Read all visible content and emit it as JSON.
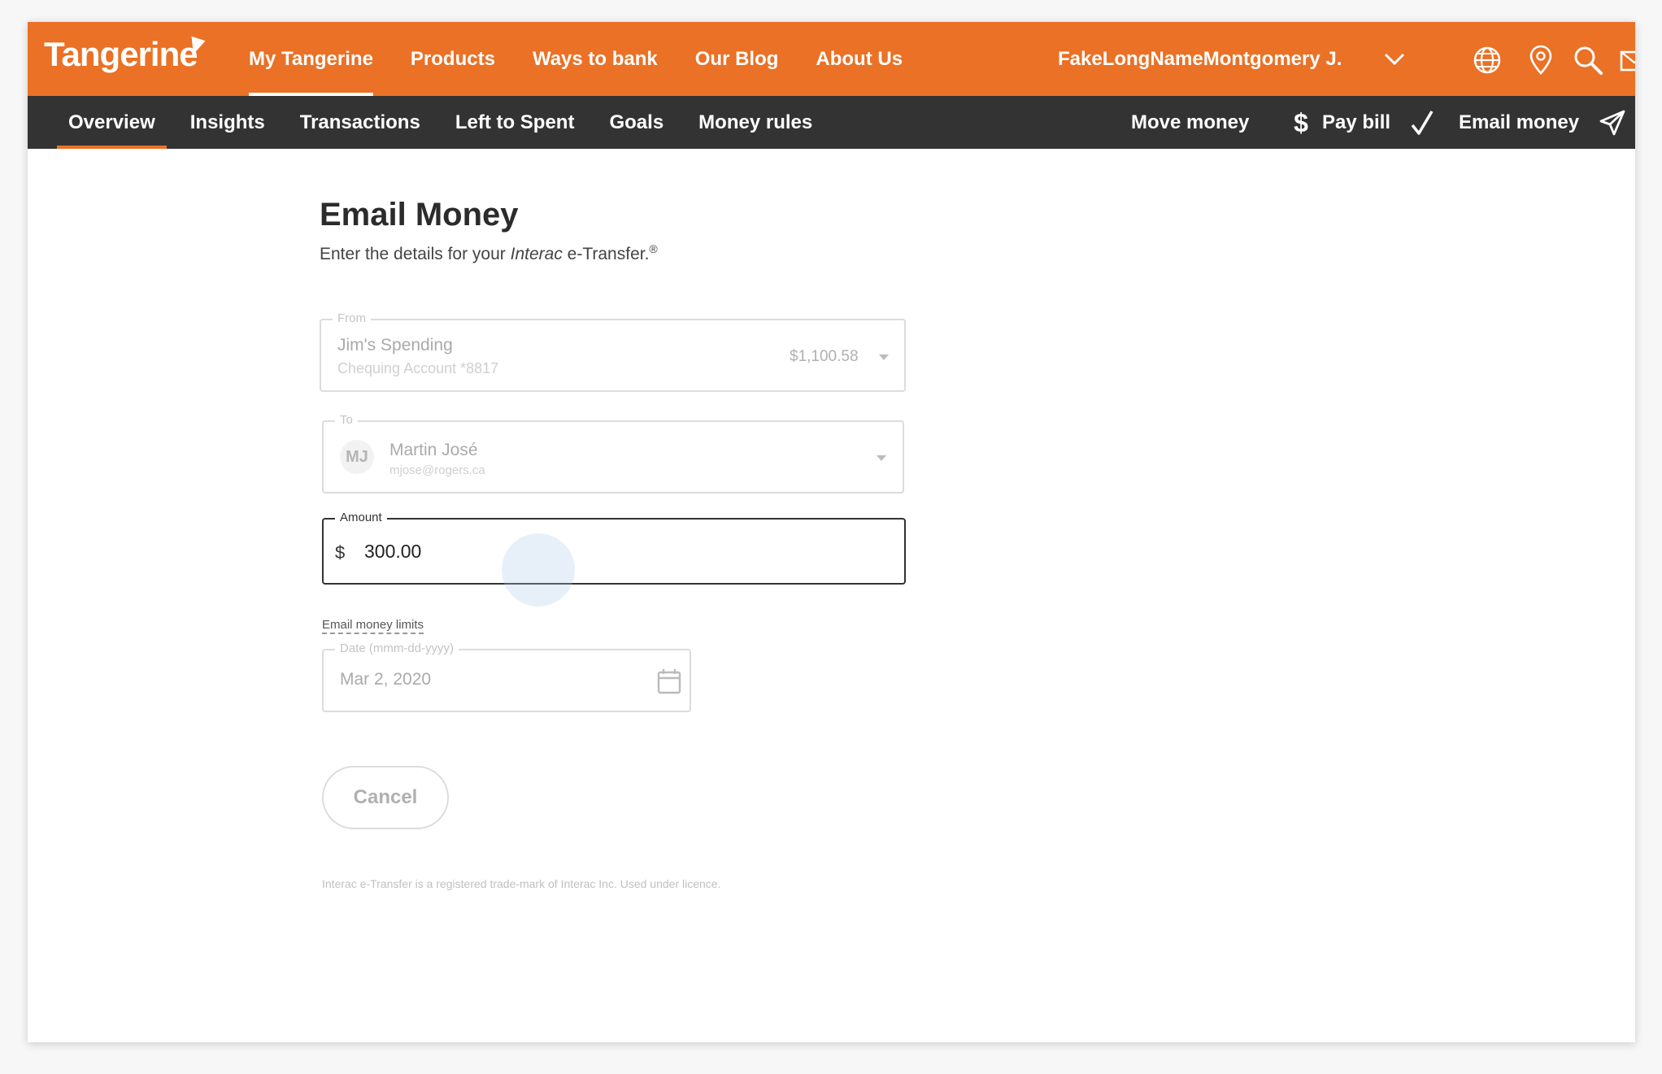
{
  "brand": {
    "name": "Tangerine",
    "accent": "#ea7125",
    "subbar_color": "#333333"
  },
  "topnav": {
    "items": [
      {
        "label": "My Tangerine",
        "active": true
      },
      {
        "label": "Products"
      },
      {
        "label": "Ways to bank"
      },
      {
        "label": "Our Blog"
      },
      {
        "label": "About Us"
      }
    ],
    "user_name": "FakeLongNameMontgomery J.",
    "icons": [
      "globe-icon",
      "location-pin-icon",
      "search-icon",
      "mail-icon"
    ]
  },
  "subnav": {
    "items": [
      {
        "label": "Overview",
        "active": true
      },
      {
        "label": "Insights"
      },
      {
        "label": "Transactions"
      },
      {
        "label": "Left to Spent"
      },
      {
        "label": "Goals"
      },
      {
        "label": "Money rules"
      }
    ],
    "quick_actions": [
      {
        "label": "Move money",
        "icon": "dollar-icon"
      },
      {
        "label": "Pay bill",
        "icon": "checkmark-icon"
      },
      {
        "label": "Email money",
        "icon": "paper-plane-icon"
      }
    ]
  },
  "form": {
    "title": "Email Money",
    "subtitle_pre": "Enter the details for your ",
    "subtitle_italic": "Interac",
    "subtitle_post": " e-Transfer.",
    "subtitle_mark": "®",
    "from": {
      "legend": "From",
      "account_name": "Jim's Spending",
      "account_detail": "Chequing Account *8817",
      "balance": "$1,100.58"
    },
    "to": {
      "legend": "To",
      "initials": "MJ",
      "name": "Martin José",
      "email": "mjose@rogers.ca"
    },
    "amount": {
      "legend": "Amount",
      "currency": "$",
      "value": "300.00"
    },
    "limits_link": "Email money limits",
    "date": {
      "legend": "Date (mmm-dd-yyyy)",
      "value": "Mar 2, 2020"
    },
    "cancel_label": "Cancel",
    "disclaimer": "Interac e-Transfer is a registered trade-mark of Interac Inc. Used under licence."
  }
}
